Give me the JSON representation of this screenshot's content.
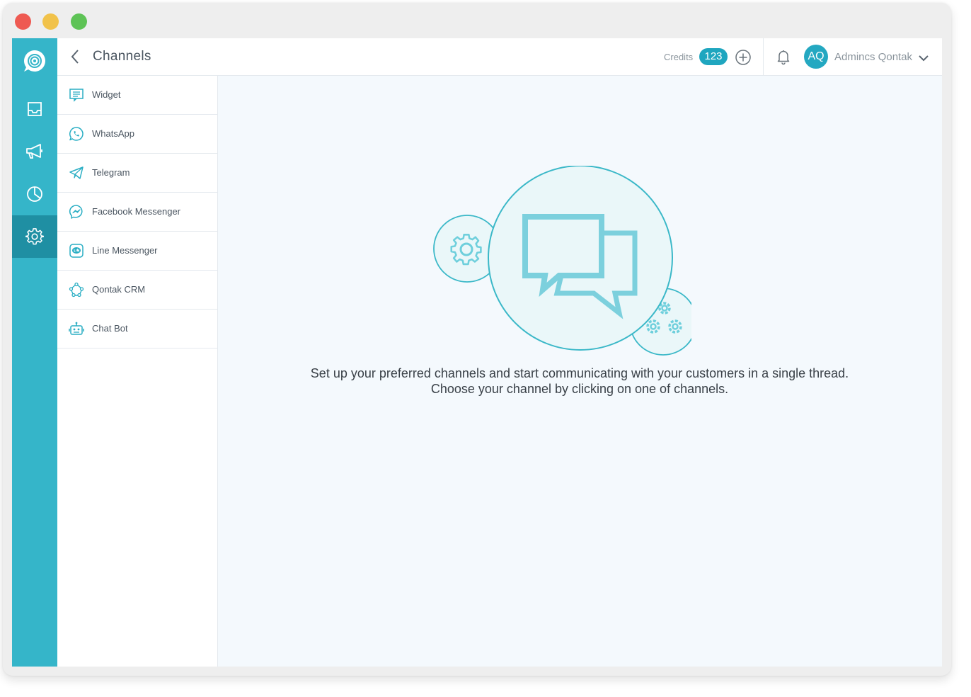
{
  "header": {
    "title": "Channels",
    "credits_label": "Credits",
    "credits_value": "123",
    "user_initials": "AQ",
    "user_name": "Admincs Qontak"
  },
  "rail": {
    "items": [
      {
        "icon": "inbox-icon"
      },
      {
        "icon": "megaphone-icon"
      },
      {
        "icon": "pie-chart-icon"
      },
      {
        "icon": "gear-icon",
        "active": true
      }
    ]
  },
  "channels": [
    {
      "label": "Widget",
      "icon": "widget-icon"
    },
    {
      "label": "WhatsApp",
      "icon": "whatsapp-icon"
    },
    {
      "label": "Telegram",
      "icon": "telegram-icon"
    },
    {
      "label": "Facebook Messenger",
      "icon": "messenger-icon"
    },
    {
      "label": "Line Messenger",
      "icon": "line-icon"
    },
    {
      "label": "Qontak CRM",
      "icon": "crm-icon"
    },
    {
      "label": "Chat Bot",
      "icon": "robot-icon"
    }
  ],
  "empty_state": {
    "line1": "Set up your preferred channels and start communicating with your customers in a single thread.",
    "line2": "Choose your channel by clicking on one of channels."
  },
  "colors": {
    "rail": "#35b5c9",
    "rail_active": "#1f8fa3",
    "accent": "#1fa6bf",
    "icon": "#2aaec4"
  }
}
